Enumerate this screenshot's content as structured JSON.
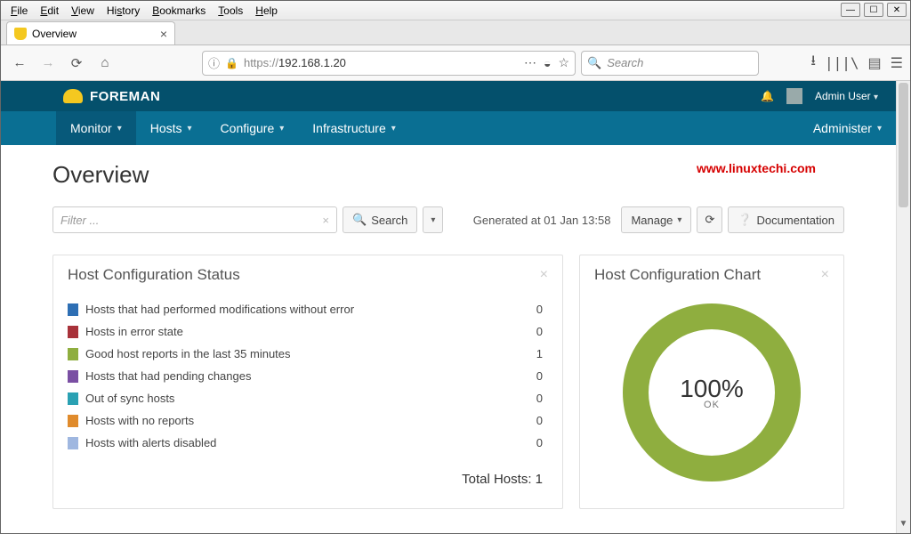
{
  "os_menu": [
    "File",
    "Edit",
    "View",
    "History",
    "Bookmarks",
    "Tools",
    "Help"
  ],
  "browser": {
    "tab_title": "Overview",
    "url_scheme": "https://",
    "url_host": "192.168.1.20",
    "search_placeholder": "Search"
  },
  "brand": "FOREMAN",
  "user": {
    "label": "Admin User"
  },
  "nav": {
    "monitor": "Monitor",
    "hosts": "Hosts",
    "configure": "Configure",
    "infrastructure": "Infrastructure",
    "administer": "Administer"
  },
  "page_title": "Overview",
  "watermark": "www.linuxtechi.com",
  "filter_placeholder": "Filter ...",
  "search_btn": "Search",
  "generated": "Generated at 01 Jan 13:58",
  "manage_btn": "Manage",
  "doc_btn": "Documentation",
  "status_panel_title": "Host Configuration Status",
  "status_rows": [
    {
      "color": "#2e6fb4",
      "label": "Hosts that had performed modifications without error",
      "value": 0
    },
    {
      "color": "#a8323a",
      "label": "Hosts in error state",
      "value": 0
    },
    {
      "color": "#8fae3f",
      "label": "Good host reports in the last 35 minutes",
      "value": 1
    },
    {
      "color": "#7a4fa3",
      "label": "Hosts that had pending changes",
      "value": 0
    },
    {
      "color": "#2aa1b3",
      "label": "Out of sync hosts",
      "value": 0
    },
    {
      "color": "#e08b2c",
      "label": "Hosts with no reports",
      "value": 0
    },
    {
      "color": "#9fb7e0",
      "label": "Hosts with alerts disabled",
      "value": 0
    }
  ],
  "total_hosts_label": "Total Hosts: 1",
  "chart_panel_title": "Host Configuration Chart",
  "chart_data": {
    "type": "pie",
    "title": "Host Configuration Chart",
    "series": [
      {
        "name": "OK",
        "value": 100,
        "color": "#8fae3f"
      }
    ],
    "center_label_pct": "100%",
    "center_label_text": "OK"
  }
}
